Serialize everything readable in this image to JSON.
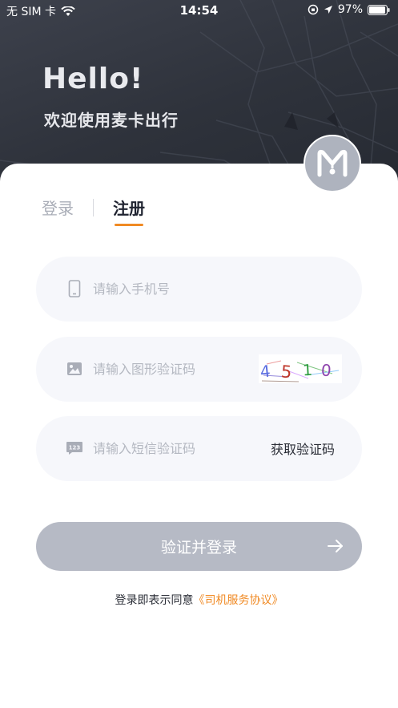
{
  "status_bar": {
    "carrier": "无 SIM 卡",
    "time": "14:54",
    "battery": "97%",
    "icons": [
      "wifi-icon",
      "orientation-lock-icon",
      "location-arrow-icon",
      "battery-icon"
    ]
  },
  "header": {
    "greeting": "Hello!",
    "welcome": "欢迎使用麦卡出行",
    "logo_icon": "maika-logo-icon"
  },
  "tabs": {
    "login_label": "登录",
    "register_label": "注册",
    "active": "注册"
  },
  "form": {
    "phone": {
      "placeholder": "请输入手机号",
      "value": "",
      "icon": "phone-icon"
    },
    "captcha": {
      "placeholder": "请输入图形验证码",
      "value": "",
      "icon": "image-icon",
      "captcha_text": "4510"
    },
    "sms": {
      "placeholder": "请输入短信验证码",
      "value": "",
      "icon": "sms-code-icon",
      "button_label": "获取验证码"
    }
  },
  "submit": {
    "label": "验证并登录",
    "icon": "arrow-right-icon"
  },
  "agreement": {
    "prefix": "登录即表示同意",
    "link_text": "《司机服务协议》"
  },
  "colors": {
    "accent": "#f08a24",
    "header_bg": "#2e323b",
    "field_bg": "#f6f7fb",
    "button_disabled": "#b6bac5"
  }
}
